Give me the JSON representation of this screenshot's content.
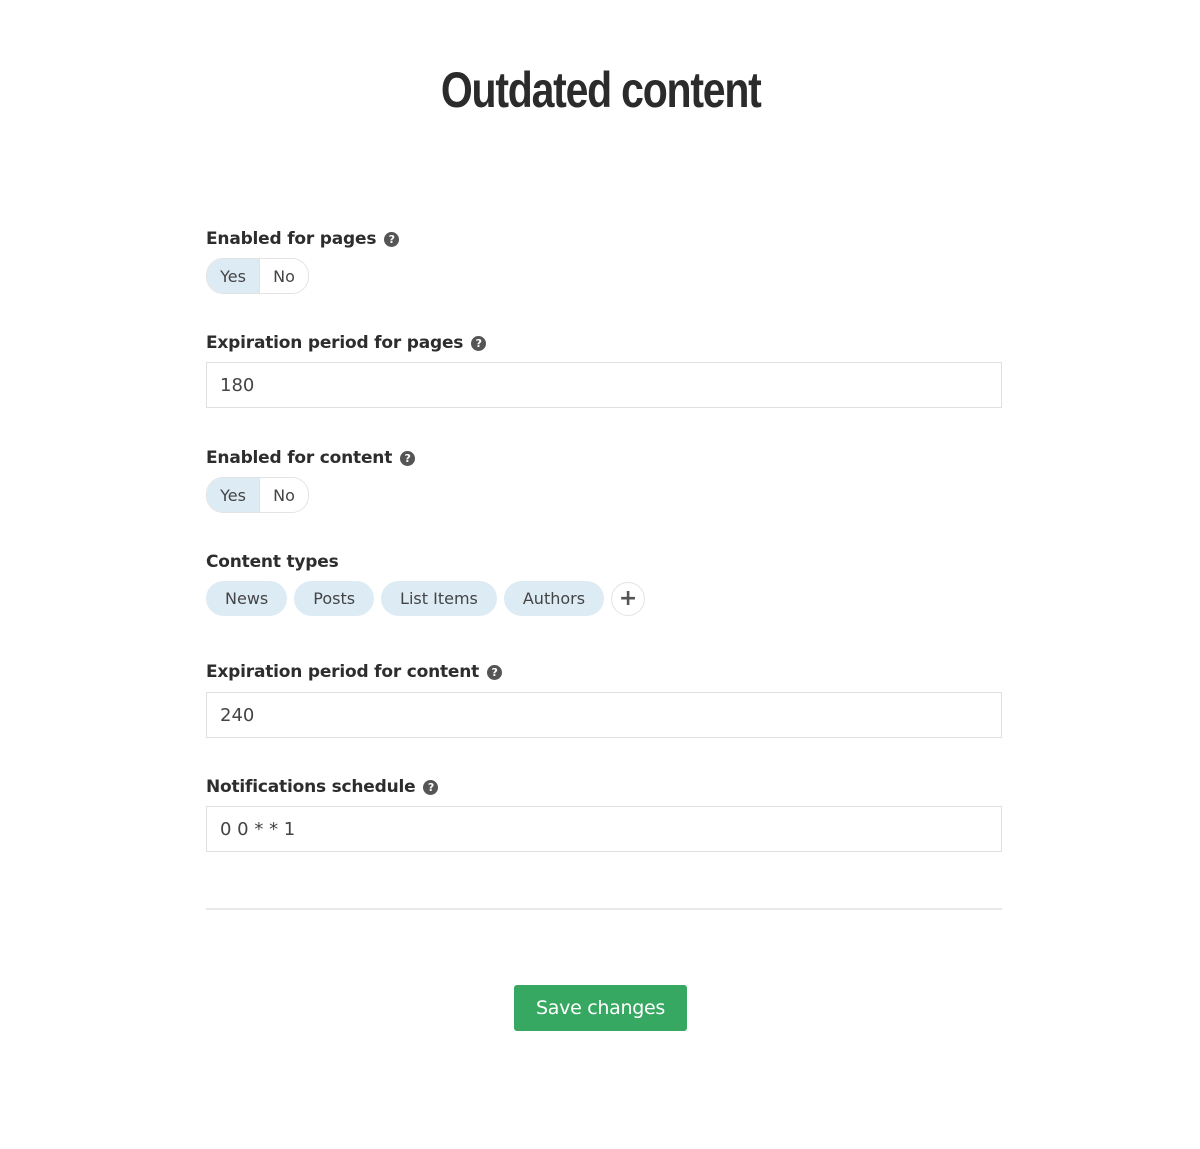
{
  "page": {
    "title": "Outdated content"
  },
  "form": {
    "enabled_pages": {
      "label": "Enabled for pages",
      "help_icon": "question-circle-icon",
      "options": [
        "Yes",
        "No"
      ],
      "selected": "Yes"
    },
    "expiration_pages": {
      "label": "Expiration period for pages",
      "help_icon": "question-circle-icon",
      "value": "180"
    },
    "enabled_content": {
      "label": "Enabled for content",
      "help_icon": "question-circle-icon",
      "options": [
        "Yes",
        "No"
      ],
      "selected": "Yes"
    },
    "content_types": {
      "label": "Content types",
      "items": [
        "News",
        "Posts",
        "List Items",
        "Authors"
      ],
      "add_icon": "plus-icon",
      "add_glyph": "+"
    },
    "expiration_content": {
      "label": "Expiration period for content",
      "help_icon": "question-circle-icon",
      "value": "240"
    },
    "notifications_schedule": {
      "label": "Notifications schedule",
      "help_icon": "question-circle-icon",
      "value": "0 0 * * 1"
    }
  },
  "icons": {
    "help_glyph": "?"
  },
  "actions": {
    "save_label": "Save changes",
    "save_color": "#37a862"
  },
  "colors": {
    "selected_toggle_bg": "#ddebf5",
    "chip_bg": "#ddebf5"
  }
}
